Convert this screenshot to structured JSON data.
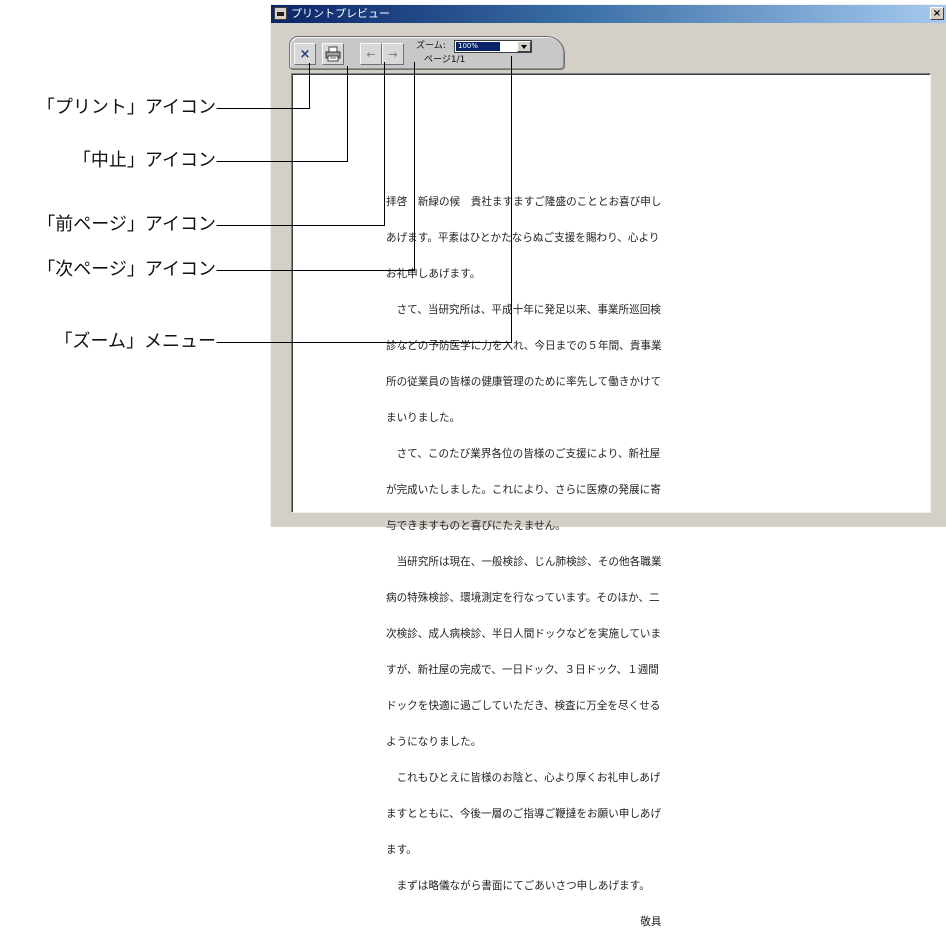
{
  "callouts": [
    "「プリント」アイコン",
    "「中止」アイコン",
    "「前ページ」アイコン",
    "「次ページ」アイコン",
    "「ズーム」メニュー"
  ],
  "window": {
    "title": "プリントプレビュー",
    "close_symbol": "×"
  },
  "toolbar": {
    "close_symbol": "×",
    "zoom_label": "ズーム:",
    "zoom_value": "100%",
    "page_label": "ページ1/1",
    "prev_symbol": "←",
    "next_symbol": "→"
  },
  "document": {
    "lines": [
      "拝啓　新緑の候　貴社ますますご隆盛のこととお喜び申し",
      "あげます。平素はひとかたならぬご支援を賜わり、心より",
      "お礼申しあげます。",
      "　さて、当研究所は、平成十年に発足以来、事業所巡回検",
      "診などの予防医学に力を入れ、今日までの５年間、貴事業",
      "所の従業員の皆様の健康管理のために率先して働きかけて",
      "まいりました。",
      "　さて、このたび業界各位の皆様のご支援により、新社屋",
      "が完成いたしました。これにより、さらに医療の発展に寄",
      "与できますものと喜びにたえません。",
      "　当研究所は現在、一般検診、じん肺検診、その他各職業",
      "病の特殊検診、環境測定を行なっています。そのほか、二",
      "次検診、成人病検診、半日人間ドックなどを実施していま",
      "すが、新社屋の完成で、一日ドック、３日ドック、１週間",
      "ドックを快適に過ごしていただき、検査に万全を尽くせる",
      "ようになりました。",
      "　これもひとえに皆様のお陰と、心より厚くお礼申しあげ",
      "ますとともに、今後一層のご指導ご鞭撻をお願い申しあげ",
      "ます。",
      "　まずは略儀ながら書面にてごあいさつ申しあげます。",
      "　　　　　　　　　　　　　　　　　　　　　　　　敬具"
    ]
  }
}
